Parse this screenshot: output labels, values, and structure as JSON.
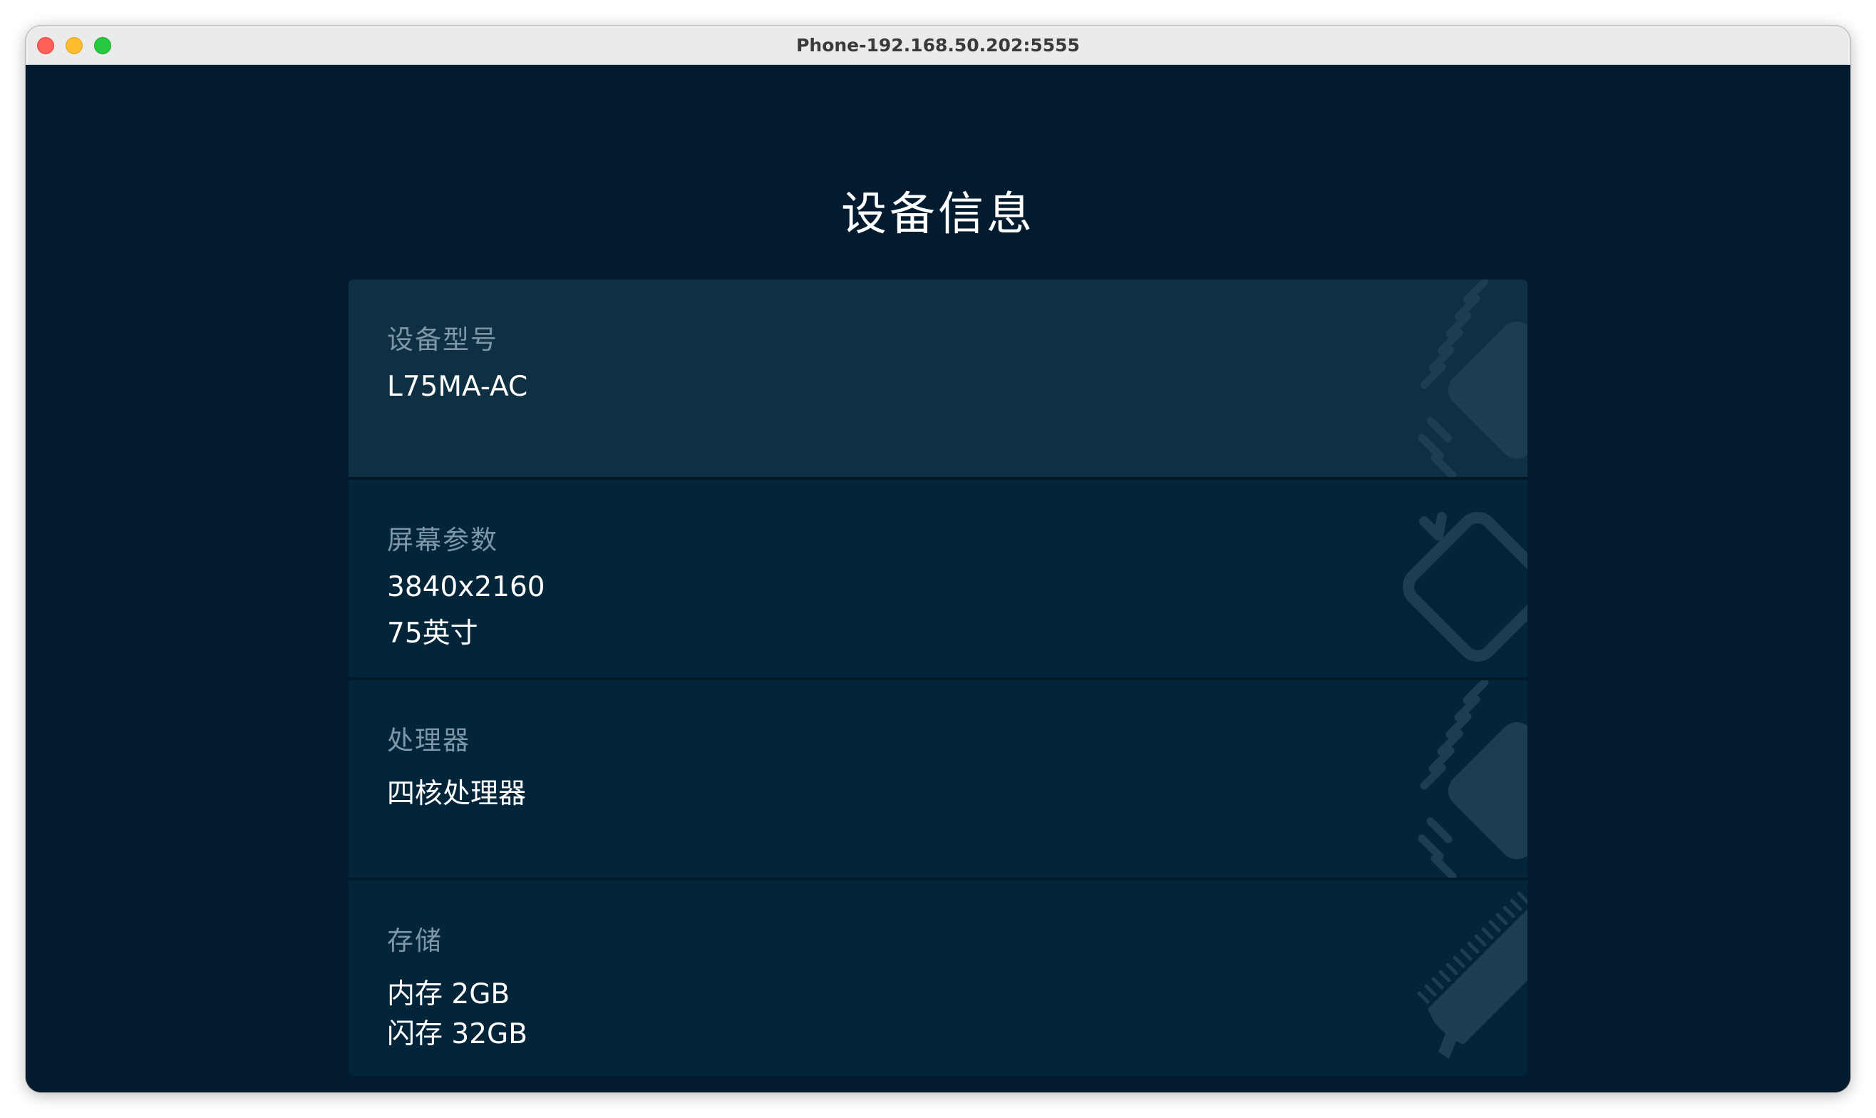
{
  "window": {
    "title": "Phone-192.168.50.202:5555"
  },
  "page": {
    "title": "设备信息"
  },
  "cards": [
    {
      "label": "设备型号",
      "lines": [
        "L75MA-AC"
      ],
      "icon": "chip-icon"
    },
    {
      "label": "屏幕参数",
      "lines": [
        "3840x2160",
        "75英寸"
      ],
      "icon": "tv-screen-icon"
    },
    {
      "label": "处理器",
      "lines": [
        "四核处理器"
      ],
      "icon": "processor-icon"
    },
    {
      "label": "存储",
      "lines": [
        "内存 2GB",
        "闪存 32GB"
      ],
      "icon": "memory-module-icon"
    }
  ],
  "colors": {
    "background": "#021b2f",
    "card": "#022539",
    "card_highlight": "#0f2f43",
    "label": "#7e97a8",
    "value": "#ffffff",
    "icon": "#1d3e52"
  }
}
